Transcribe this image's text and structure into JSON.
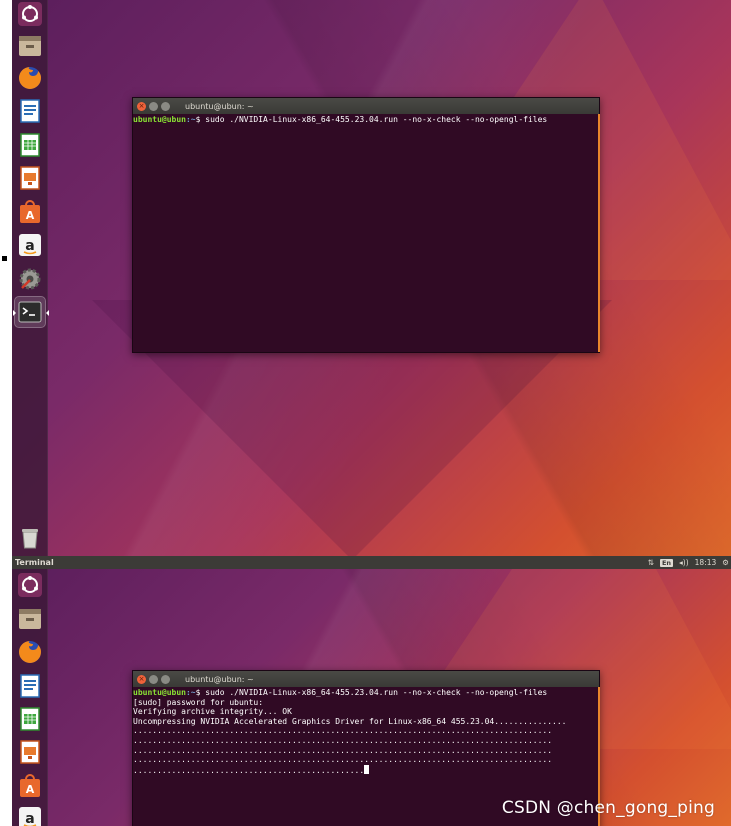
{
  "top_panel": {
    "app_name": "Terminal",
    "lang": "En",
    "clock": "18:13"
  },
  "launcher": {
    "items": [
      {
        "name": "dash",
        "icon": "ubuntu-dash-icon"
      },
      {
        "name": "files",
        "icon": "files-icon"
      },
      {
        "name": "firefox",
        "icon": "firefox-icon"
      },
      {
        "name": "writer",
        "icon": "libreoffice-writer-icon"
      },
      {
        "name": "calc",
        "icon": "libreoffice-calc-icon"
      },
      {
        "name": "impress",
        "icon": "libreoffice-impress-icon"
      },
      {
        "name": "software",
        "icon": "software-center-icon"
      },
      {
        "name": "amazon",
        "icon": "amazon-icon"
      },
      {
        "name": "settings",
        "icon": "system-settings-icon"
      },
      {
        "name": "terminal",
        "icon": "terminal-icon"
      }
    ],
    "trash_icon": "trash-icon"
  },
  "terminal_top": {
    "title": "ubuntu@ubun: ~",
    "lines": [
      {
        "user": "ubuntu@ubun",
        "path": ":~",
        "cmd": "$ sudo ./NVIDIA-Linux-x86_64-455.23.04.run --no-x-check --no-opengl-files"
      }
    ]
  },
  "terminal_bottom": {
    "title": "ubuntu@ubun: ~",
    "prompt_user": "ubuntu@ubun",
    "prompt_path": ":~",
    "prompt_cmd": "$ sudo ./NVIDIA-Linux-x86_64-455.23.04.run --no-x-check --no-opengl-files",
    "output": [
      "[sudo] password for ubuntu:",
      "Verifying archive integrity... OK",
      "Uncompressing NVIDIA Accelerated Graphics Driver for Linux-x86_64 455.23.04...............",
      ".......................................................................................",
      ".......................................................................................",
      ".......................................................................................",
      ".......................................................................................",
      "................................................"
    ]
  },
  "watermark": "CSDN @chen_gong_ping"
}
